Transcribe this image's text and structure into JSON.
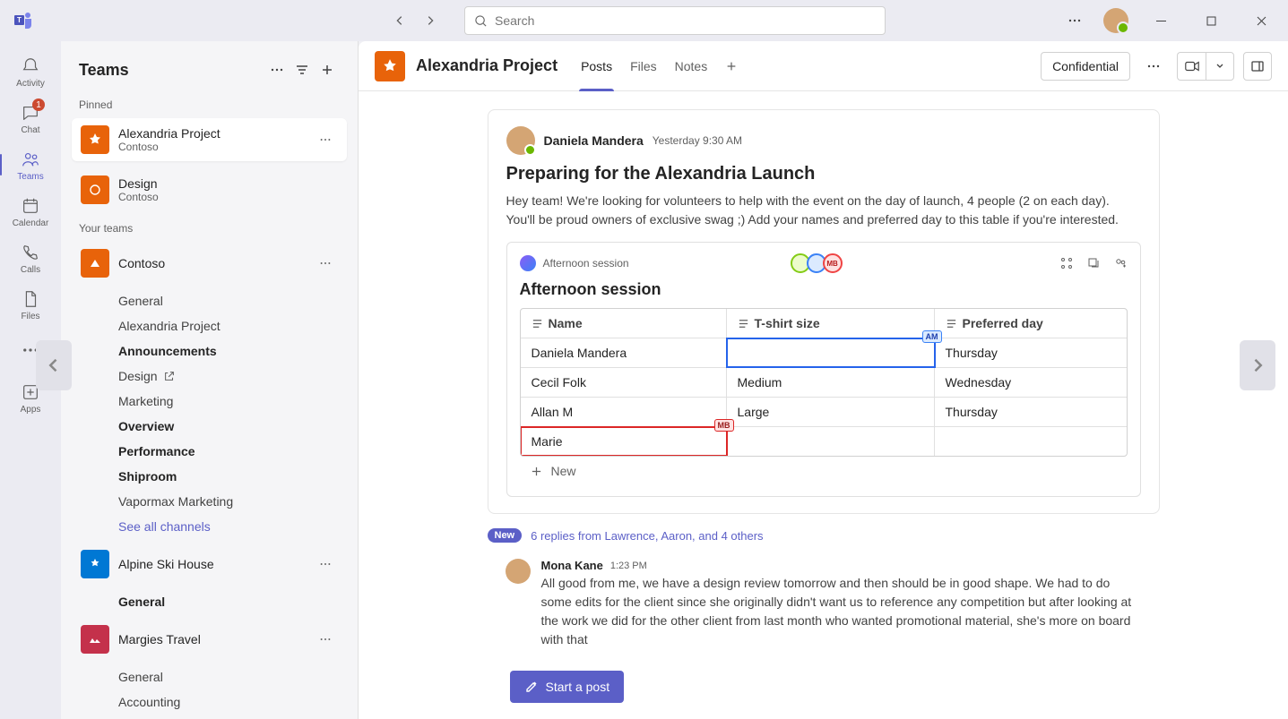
{
  "app": {
    "search_placeholder": "Search"
  },
  "rail": {
    "items": [
      {
        "label": "Activity"
      },
      {
        "label": "Chat",
        "badge": "1"
      },
      {
        "label": "Teams"
      },
      {
        "label": "Calendar"
      },
      {
        "label": "Calls"
      },
      {
        "label": "Files"
      }
    ],
    "more": "",
    "apps": "Apps"
  },
  "sidebar": {
    "title": "Teams",
    "pinned_label": "Pinned",
    "your_teams_label": "Your teams",
    "pinned": [
      {
        "name": "Alexandria Project",
        "sub": "Contoso"
      },
      {
        "name": "Design",
        "sub": "Contoso"
      }
    ],
    "teams": [
      {
        "name": "Contoso",
        "channels": [
          {
            "name": "General"
          },
          {
            "name": "Alexandria Project"
          },
          {
            "name": "Announcements",
            "bold": true
          },
          {
            "name": "Design",
            "shared": true
          },
          {
            "name": "Marketing"
          },
          {
            "name": "Overview",
            "bold": true
          },
          {
            "name": "Performance",
            "bold": true
          },
          {
            "name": "Shiproom",
            "bold": true
          },
          {
            "name": "Vapormax Marketing"
          }
        ],
        "see_all": "See all channels"
      },
      {
        "name": "Alpine Ski House",
        "channels": [
          {
            "name": "General",
            "bold": true
          }
        ]
      },
      {
        "name": "Margies Travel",
        "channels": [
          {
            "name": "General"
          },
          {
            "name": "Accounting"
          }
        ]
      }
    ]
  },
  "channel_header": {
    "title": "Alexandria Project",
    "tabs": [
      "Posts",
      "Files",
      "Notes"
    ],
    "confidential": "Confidential"
  },
  "post": {
    "author": "Daniela Mandera",
    "time": "Yesterday 9:30 AM",
    "title": "Preparing for the Alexandria Launch",
    "body": "Hey team! We're looking for volunteers to help with the event on the day of launch, 4 people (2 on each day). You'll be proud owners of exclusive swag ;) Add your names and preferred day to this table if you're interested."
  },
  "loop": {
    "header_label": "Afternoon session",
    "title": "Afternoon session",
    "presence_mb": "MB",
    "tag_am": "AM",
    "tag_mb": "MB",
    "columns": [
      "Name",
      "T-shirt size",
      "Preferred day"
    ],
    "rows": [
      {
        "name": "Daniela Mandera",
        "size": "",
        "day": "Thursday"
      },
      {
        "name": "Cecil Folk",
        "size": "Medium",
        "day": "Wednesday"
      },
      {
        "name": "Allan M",
        "size": "Large",
        "day": "Thursday"
      },
      {
        "name": "Marie",
        "size": "",
        "day": ""
      }
    ],
    "add_new": "New"
  },
  "replies": {
    "new": "New",
    "summary": "6 replies from Lawrence, Aaron, and 4 others",
    "last": {
      "author": "Mona Kane",
      "time": "1:23 PM",
      "body": "All good from me, we have a design review tomorrow and then should be in good shape. We had to do some edits for the client since she originally didn't want us to reference any competition but after looking at the work we did for the other client from last month who wanted promotional material, she's more on board with that"
    }
  },
  "compose": {
    "start": "Start a post"
  }
}
